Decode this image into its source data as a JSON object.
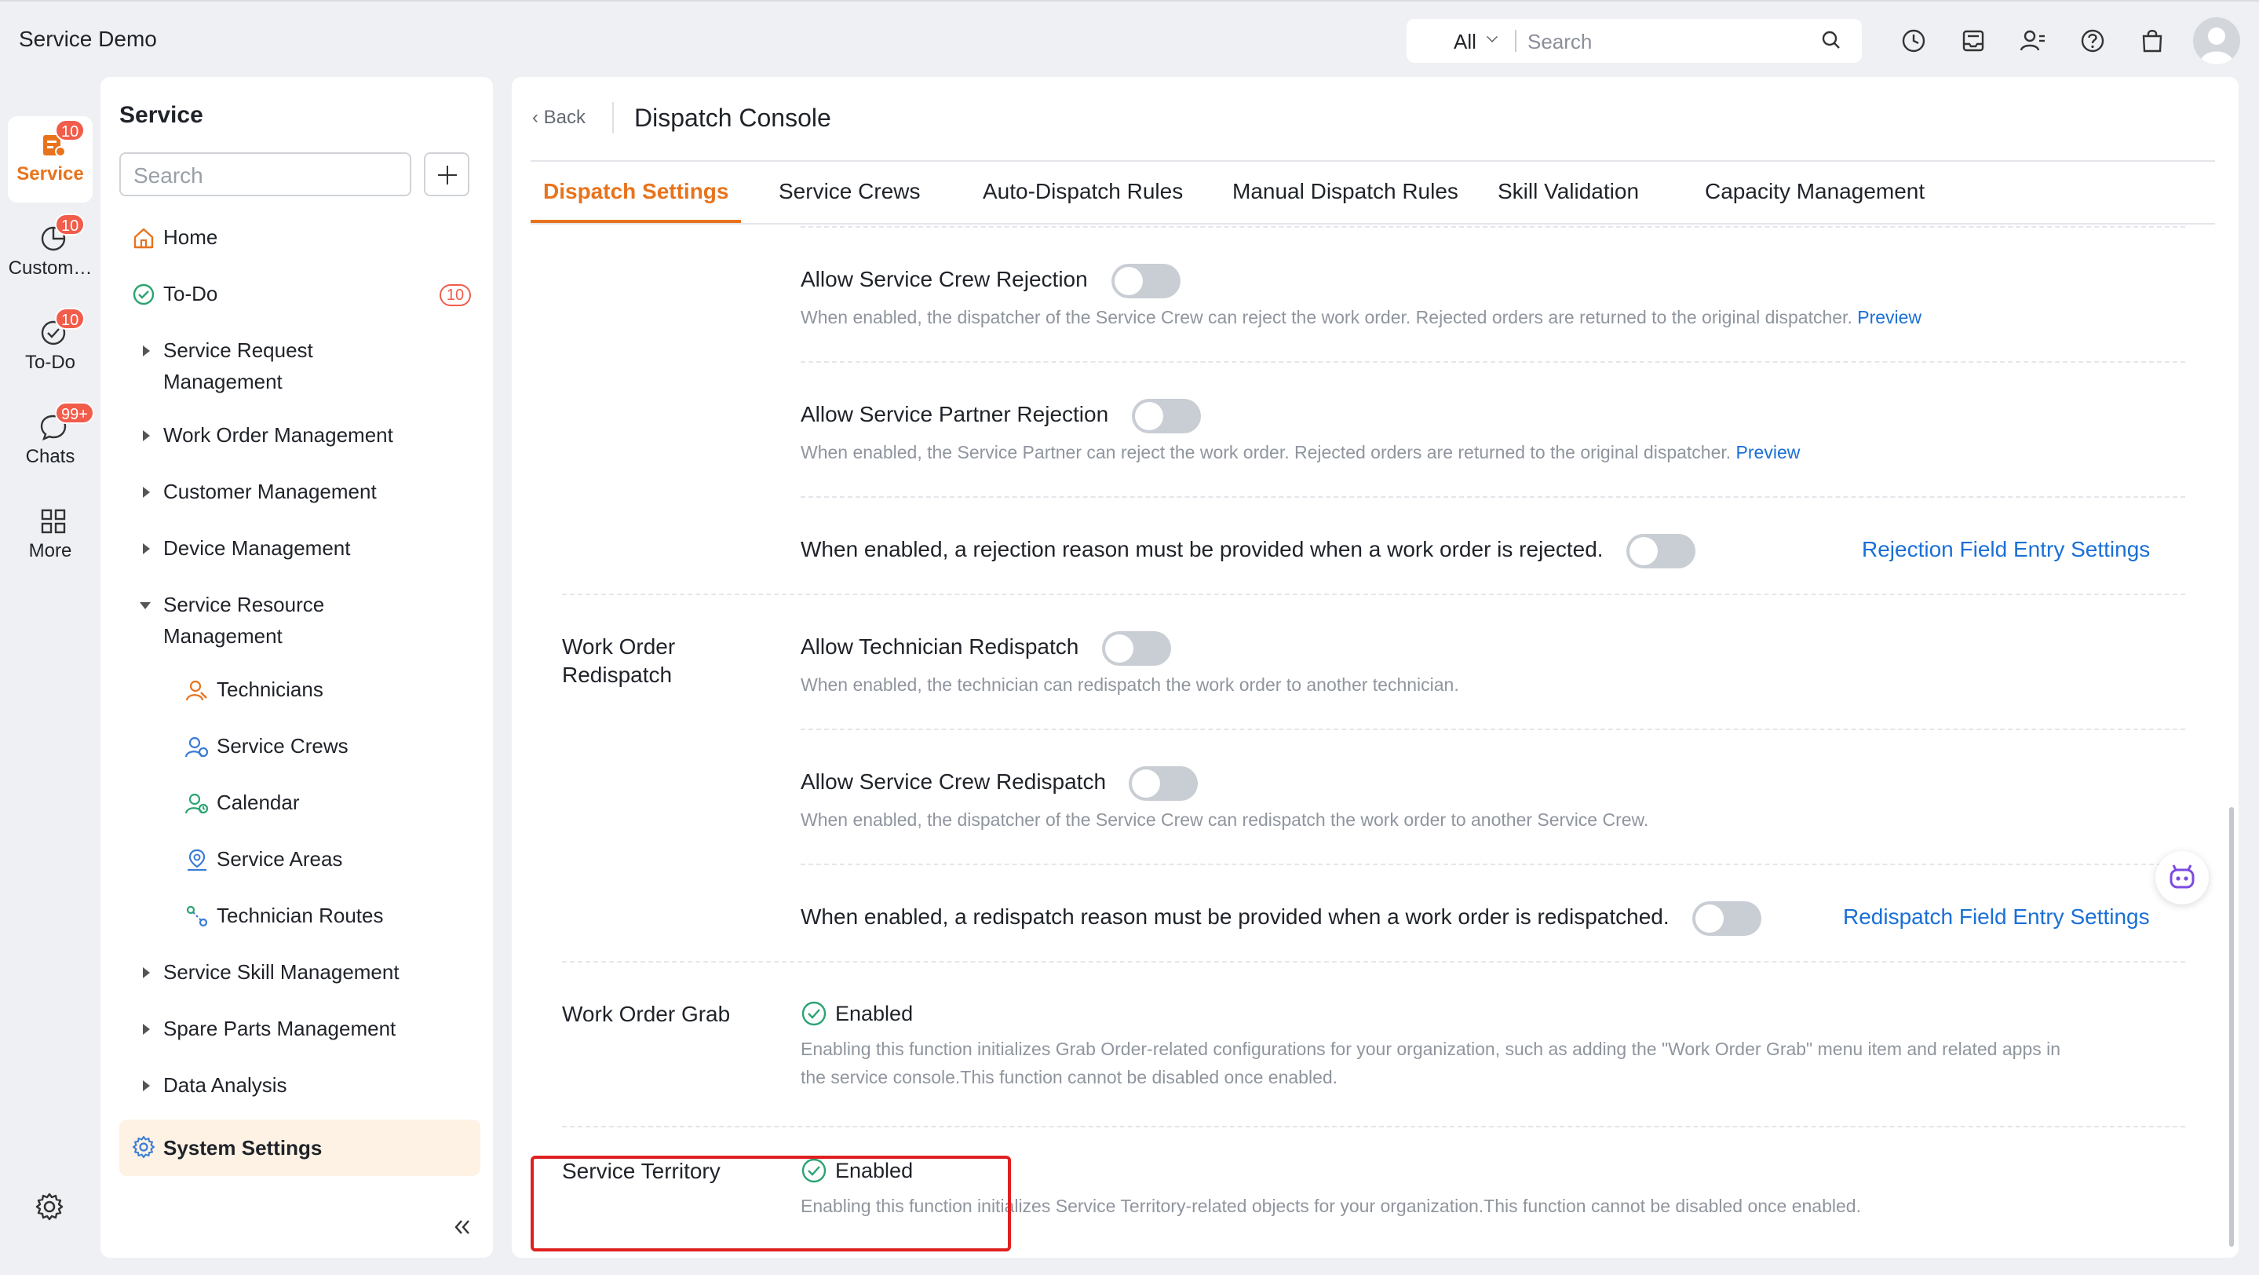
{
  "app": {
    "title": "Service Demo"
  },
  "topbar": {
    "scope": "All",
    "search_placeholder": "Search"
  },
  "rail": {
    "items": [
      {
        "label": "Service",
        "badge": "10",
        "icon": "service-icon"
      },
      {
        "label": "Custom…",
        "badge": "10",
        "icon": "customer-icon"
      },
      {
        "label": "To-Do",
        "badge": "10",
        "icon": "todo-icon"
      },
      {
        "label": "Chats",
        "badge": "99+",
        "icon": "chat-icon"
      },
      {
        "label": "More",
        "badge": "",
        "icon": "grid-icon"
      }
    ]
  },
  "sidebar": {
    "title": "Service",
    "search_placeholder": "Search",
    "home": "Home",
    "todo": "To-Do",
    "todo_badge": "10",
    "service_request_1": "Service Request",
    "service_request_2": "Management",
    "work_order": "Work Order Management",
    "customer": "Customer Management",
    "device": "Device Management",
    "service_resource_1": "Service Resource",
    "service_resource_2": "Management",
    "technicians": "Technicians",
    "service_crews": "Service Crews",
    "calendar": "Calendar",
    "service_areas": "Service Areas",
    "technician_routes": "Technician Routes",
    "skill": "Service Skill Management",
    "spare_parts": "Spare Parts Management",
    "data_analysis": "Data Analysis",
    "system_settings": "System Settings"
  },
  "main": {
    "back": "Back",
    "title": "Dispatch Console",
    "tabs": [
      "Dispatch Settings",
      "Service Crews",
      "Auto-Dispatch Rules",
      "Manual Dispatch Rules",
      "Skill Validation",
      "Capacity Management"
    ],
    "crew_rejection": {
      "title": "Allow Service Crew Rejection",
      "desc": "When enabled, the dispatcher of the Service Crew can reject the work order. Rejected orders are returned to the original dispatcher.",
      "preview": "Preview",
      "enabled": false
    },
    "partner_rejection": {
      "title": "Allow Service Partner Rejection",
      "desc": "When enabled, the Service Partner can reject the work order. Rejected orders are returned to the original dispatcher.",
      "preview": "Preview",
      "enabled": false
    },
    "rejection_reason": {
      "title": "When enabled, a rejection reason must be provided when a work order is rejected.",
      "link": "Rejection Field Entry Settings",
      "enabled": false
    },
    "redispatch": {
      "label_1": "Work Order",
      "label_2": "Redispatch",
      "tech": {
        "title": "Allow Technician Redispatch",
        "desc": "When enabled, the technician can redispatch the work order to another technician.",
        "enabled": false
      },
      "crew": {
        "title": "Allow Service Crew Redispatch",
        "desc": "When enabled, the dispatcher of the Service Crew can redispatch the work order to another Service Crew.",
        "enabled": false
      },
      "reason": {
        "title": "When enabled, a redispatch reason must be provided when a work order is redispatched.",
        "link": "Redispatch Field Entry Settings",
        "enabled": false
      }
    },
    "grab": {
      "label": "Work Order Grab",
      "status": "Enabled",
      "desc_1": "Enabling this function initializes Grab Order-related configurations for your organization, such as adding the \"Work Order Grab\" menu item and related apps in",
      "desc_2": "the service console.This function cannot be disabled once enabled."
    },
    "territory": {
      "label": "Service Territory",
      "status": "Enabled",
      "desc": "Enabling this function initializes Service Territory-related objects for your organization.This function cannot be disabled once enabled."
    }
  },
  "colors": {
    "accent": "#e8731c",
    "link": "#1a6fd6",
    "badge": "#f25c4a",
    "enabled_check": "#2ba471",
    "highlight": "#e02020"
  }
}
